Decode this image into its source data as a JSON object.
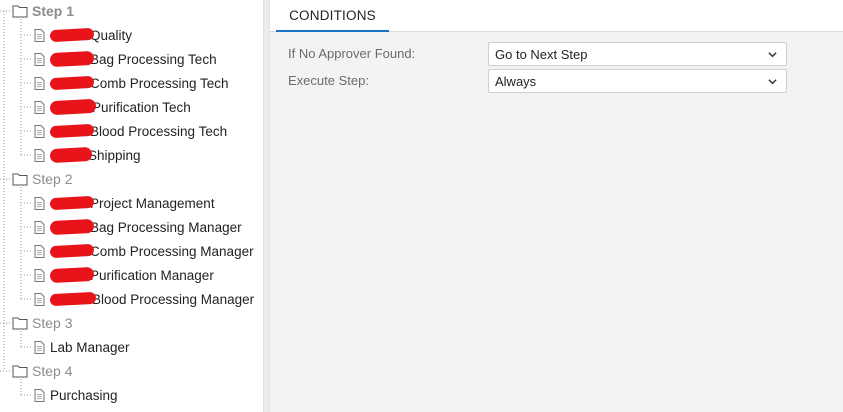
{
  "tree": {
    "steps": [
      {
        "label": "Step 1",
        "active": true,
        "items": [
          {
            "prefix": "",
            "label": "Quality",
            "redacted": true
          },
          {
            "prefix": "",
            "label": "Bag Processing Tech",
            "redacted": true
          },
          {
            "prefix": "",
            "label": "Comb Processing Tech",
            "redacted": true
          },
          {
            "prefix": "",
            "label": "Purification Tech",
            "redacted": true
          },
          {
            "prefix": "",
            "label": "Blood Processing Tech",
            "redacted": true
          },
          {
            "prefix": "",
            "label": "Shipping",
            "redacted": true
          }
        ]
      },
      {
        "label": "Step 2",
        "active": false,
        "items": [
          {
            "prefix": "",
            "label": "Project Management",
            "redacted": true
          },
          {
            "prefix": "",
            "label": "Bag Processing Manager",
            "redacted": true
          },
          {
            "prefix": "",
            "label": "Comb Processing Manager",
            "redacted": true
          },
          {
            "prefix": "",
            "label": "Purification Manager",
            "redacted": true
          },
          {
            "prefix": "",
            "label": "Blood Processing Manager",
            "redacted": true
          }
        ]
      },
      {
        "label": "Step 3",
        "active": false,
        "items": [
          {
            "prefix": "",
            "label": "Lab Manager",
            "redacted": false
          }
        ]
      },
      {
        "label": "Step 4",
        "active": false,
        "items": [
          {
            "prefix": "",
            "label": "Purchasing",
            "redacted": false
          }
        ]
      }
    ]
  },
  "panel": {
    "tabs": [
      {
        "label": "CONDITIONS",
        "active": true
      }
    ],
    "fields": [
      {
        "label": "If No Approver Found:",
        "value": "Go to Next Step"
      },
      {
        "label": "Execute Step:",
        "value": "Always"
      }
    ]
  },
  "colors": {
    "accent": "#1a73c8",
    "redaction": "#e8141a",
    "panel_bg": "#f3f3f3",
    "step_label": "#8c8c8c"
  },
  "icons": {
    "step": "folder-icon",
    "item": "document-icon",
    "dropdown": "chevron-down-icon"
  }
}
